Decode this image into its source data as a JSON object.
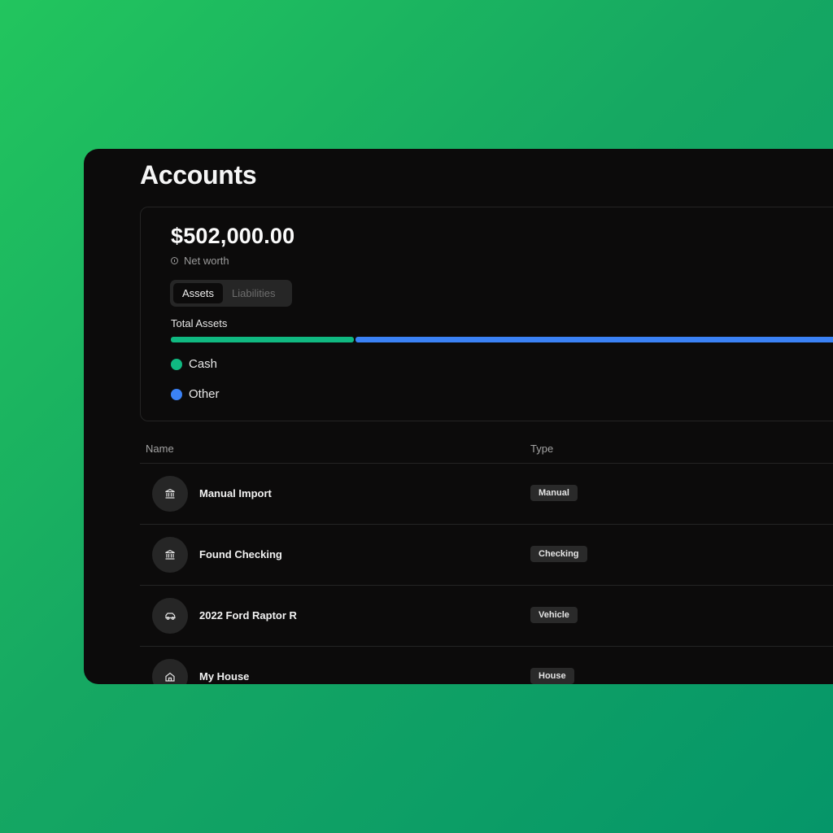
{
  "page": {
    "title": "Accounts"
  },
  "summary": {
    "net_worth_amount": "$502,000.00",
    "net_worth_label": "Net worth",
    "toggle": {
      "assets_label": "Assets",
      "liabilities_label": "Liabilities",
      "selected": "Assets"
    },
    "total_label": "Total Assets",
    "breakdown": [
      {
        "label": "Cash",
        "color": "#10b981",
        "share": 0.265
      },
      {
        "label": "Other",
        "color": "#3b82f6",
        "share": 0.735
      }
    ]
  },
  "table": {
    "columns": {
      "name": "Name",
      "type": "Type"
    },
    "rows": [
      {
        "name": "Manual Import",
        "type": "Manual",
        "icon": "bank-icon"
      },
      {
        "name": "Found Checking",
        "type": "Checking",
        "icon": "bank-icon"
      },
      {
        "name": "2022 Ford Raptor R",
        "type": "Vehicle",
        "icon": "car-icon"
      },
      {
        "name": "My House",
        "type": "House",
        "icon": "house-icon"
      }
    ]
  },
  "colors": {
    "background_gradient_start": "#22c55e",
    "background_gradient_end": "#059669",
    "panel": "#0c0b0b",
    "cash": "#10b981",
    "other": "#3b82f6"
  }
}
